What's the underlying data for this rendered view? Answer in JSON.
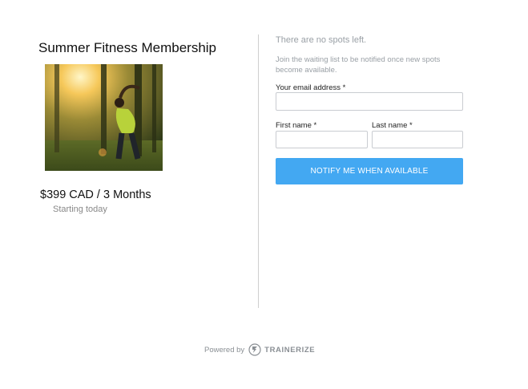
{
  "product": {
    "title": "Summer Fitness Membership",
    "image_alt": "woman stretching in sunlit forest",
    "price": "$399 CAD / 3 Months",
    "start": "Starting today"
  },
  "waitlist": {
    "status": "There are no spots left.",
    "description": "Join the waiting list to be notified once new spots become available.",
    "email_label": "Your email address *",
    "email_value": "",
    "first_name_label": "First name *",
    "first_name_value": "",
    "last_name_label": "Last name *",
    "last_name_value": "",
    "button_label": "NOTIFY ME WHEN AVAILABLE"
  },
  "footer": {
    "powered_by": "Powered by",
    "brand": "TRAINERIZE",
    "brand_icon": "trainerize-logo-icon"
  },
  "colors": {
    "accent": "#43a8f2",
    "muted_text": "#9aa0a6",
    "divider": "#cfcfcf"
  }
}
